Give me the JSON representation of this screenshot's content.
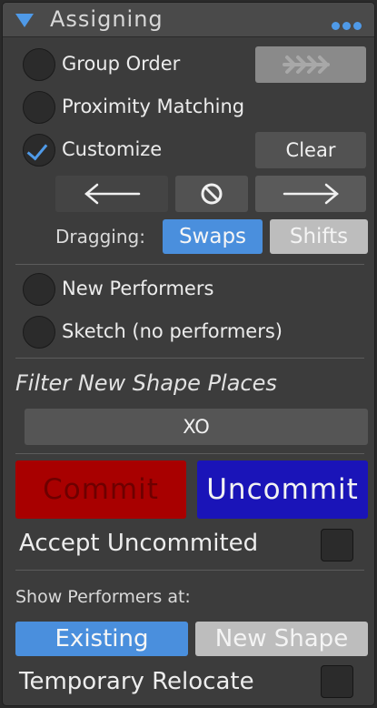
{
  "header": {
    "title": "Assigning",
    "menu_icon": "ellipsis-icon",
    "collapse_icon": "triangle-down-icon"
  },
  "assign_modes": [
    {
      "label": "Group Order",
      "selected": false
    },
    {
      "label": "Proximity Matching",
      "selected": false
    },
    {
      "label": "Customize",
      "selected": true
    }
  ],
  "group_order_button": {
    "icon": "chevrons-right-icon",
    "enabled": false
  },
  "clear_label": "Clear",
  "arrows": {
    "left_icon": "arrow-left-icon",
    "none_icon": "prohibit-icon",
    "right_icon": "arrow-right-icon"
  },
  "dragging": {
    "label": "Dragging:",
    "options": [
      "Swaps",
      "Shifts"
    ],
    "selected": "Swaps"
  },
  "new_modes": [
    {
      "label": "New Performers",
      "selected": false
    },
    {
      "label": "Sketch (no performers)",
      "selected": false
    }
  ],
  "filter": {
    "title": "Filter New Shape Places",
    "value": "XO"
  },
  "commit_label": "Commit",
  "uncommit_label": "Uncommit",
  "accept_uncommitted": {
    "label": "Accept Uncommited",
    "checked": false
  },
  "show_performers": {
    "label": "Show Performers at:",
    "options": [
      "Existing",
      "New Shape"
    ],
    "selected": "Existing"
  },
  "temporary_relocate": {
    "label": "Temporary Relocate",
    "checked": false
  },
  "colors": {
    "accent": "#4f9ae8",
    "commit_bg": "#a80000",
    "commit_text": "#6e0000",
    "uncommit_bg": "#1a14b8"
  }
}
